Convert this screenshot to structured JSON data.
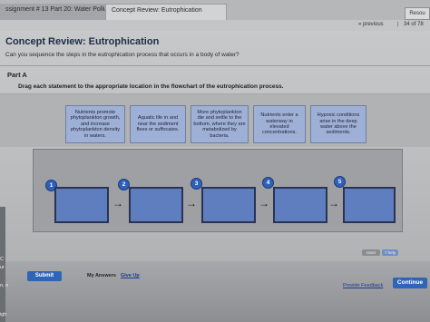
{
  "tabs": {
    "assignment": "ssignment # 13 Part 20: Water Pollut...",
    "concept": "Concept Review: Eutrophication",
    "resume": "Resou"
  },
  "nav": {
    "previous": "« previous",
    "separator": "|",
    "count": "34 of 78"
  },
  "page": {
    "title": "Concept Review: Eutrophication",
    "question": "Can you sequence the steps in the eutrophication process that occurs in a body of water?",
    "part": "Part A",
    "instruction": "Drag each statement to the appropriate location in the flowchart of the eutrophication process."
  },
  "cards": [
    "Nutrients promote phytoplankton growth, and increase phytoplankton density in waters.",
    "Aquatic life in and near the sediment flees or suffocates.",
    "More phytoplankton die and settle to the bottom, where they are metabolized by bacteria.",
    "Nutrients enter a waterway in elevated concentrations.",
    "Hypoxic conditions arise in the deep water above the sediments."
  ],
  "flow": {
    "numbers": [
      "1",
      "2",
      "3",
      "4",
      "5"
    ],
    "arrow": "→"
  },
  "board_buttons": {
    "reset": "reset",
    "help": "? help"
  },
  "footer": {
    "submit": "Submit",
    "my_answers": "My Answers",
    "give_up": "Give Up",
    "feedback": "Provide Feedback",
    "continue": "Continue"
  },
  "edge_labels": [
    "C",
    "ur",
    "n, e",
    "igh"
  ],
  "colors": {
    "card": "#9fb0d6",
    "slot": "#5f7ec0",
    "accent": "#2f65b8"
  }
}
